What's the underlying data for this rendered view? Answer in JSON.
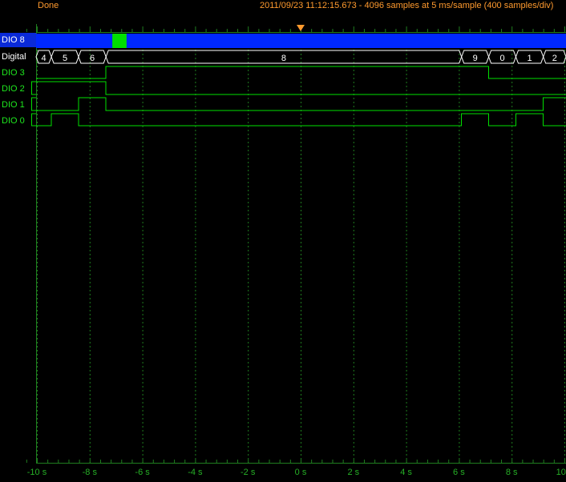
{
  "status": {
    "state": "Done",
    "info": "2011/09/23  11:12:15.673 - 4096 samples at 5 ms/sample (400 samples/div)"
  },
  "colors": {
    "signal": "#00e000",
    "grid": "#1f7d1f",
    "bus_selected": "#0028ff",
    "bus_marker": "#00e000",
    "trigger": "#ff9a2e",
    "text_orange": "#ff9a2e"
  },
  "channels": [
    {
      "name": "DIO 8",
      "type": "selected-bus"
    },
    {
      "name": "Digital",
      "type": "bus"
    },
    {
      "name": "DIO 3",
      "type": "digital"
    },
    {
      "name": "DIO 2",
      "type": "digital"
    },
    {
      "name": "DIO 1",
      "type": "digital"
    },
    {
      "name": "DIO 0",
      "type": "digital"
    }
  ],
  "time_axis": {
    "unit": "s",
    "range": [
      -10.5,
      10.3
    ],
    "trigger_time": 0,
    "tick_labels": [
      "-10 s",
      "-8 s",
      "-6 s",
      "-4 s",
      "-2 s",
      "0 s",
      "2 s",
      "4 s",
      "6 s",
      "8 s",
      "10 s"
    ],
    "tick_values": [
      -10,
      -8,
      -6,
      -4,
      -2,
      0,
      2,
      4,
      6,
      8,
      10
    ]
  },
  "dio8_marker": {
    "start": -7.14,
    "end": -6.6
  },
  "bus": {
    "segments": [
      {
        "value": "4",
        "start": -10.5,
        "end": -9.45
      },
      {
        "value": "5",
        "start": -9.45,
        "end": -8.42
      },
      {
        "value": "6",
        "start": -8.42,
        "end": -7.38
      },
      {
        "value": "8",
        "start": -7.38,
        "end": 6.1
      },
      {
        "value": "9",
        "start": 6.1,
        "end": 7.13
      },
      {
        "value": "0",
        "start": 7.13,
        "end": 8.16
      },
      {
        "value": "1",
        "start": 8.16,
        "end": 9.2
      },
      {
        "value": "2",
        "start": 9.2,
        "end": 10.3
      }
    ]
  },
  "signals": {
    "dio3": {
      "initial": 0,
      "edges": [
        -7.38,
        7.13
      ]
    },
    "dio2": {
      "initial": 0,
      "edges": [
        -10.2,
        -7.38
      ]
    },
    "dio1": {
      "initial": 1,
      "edges": [
        -10.2,
        -8.42,
        -7.38,
        9.2
      ]
    },
    "dio0": {
      "initial": 1,
      "edges": [
        -10.2,
        -9.45,
        -8.42,
        6.1,
        7.13,
        8.16,
        9.2
      ]
    }
  }
}
